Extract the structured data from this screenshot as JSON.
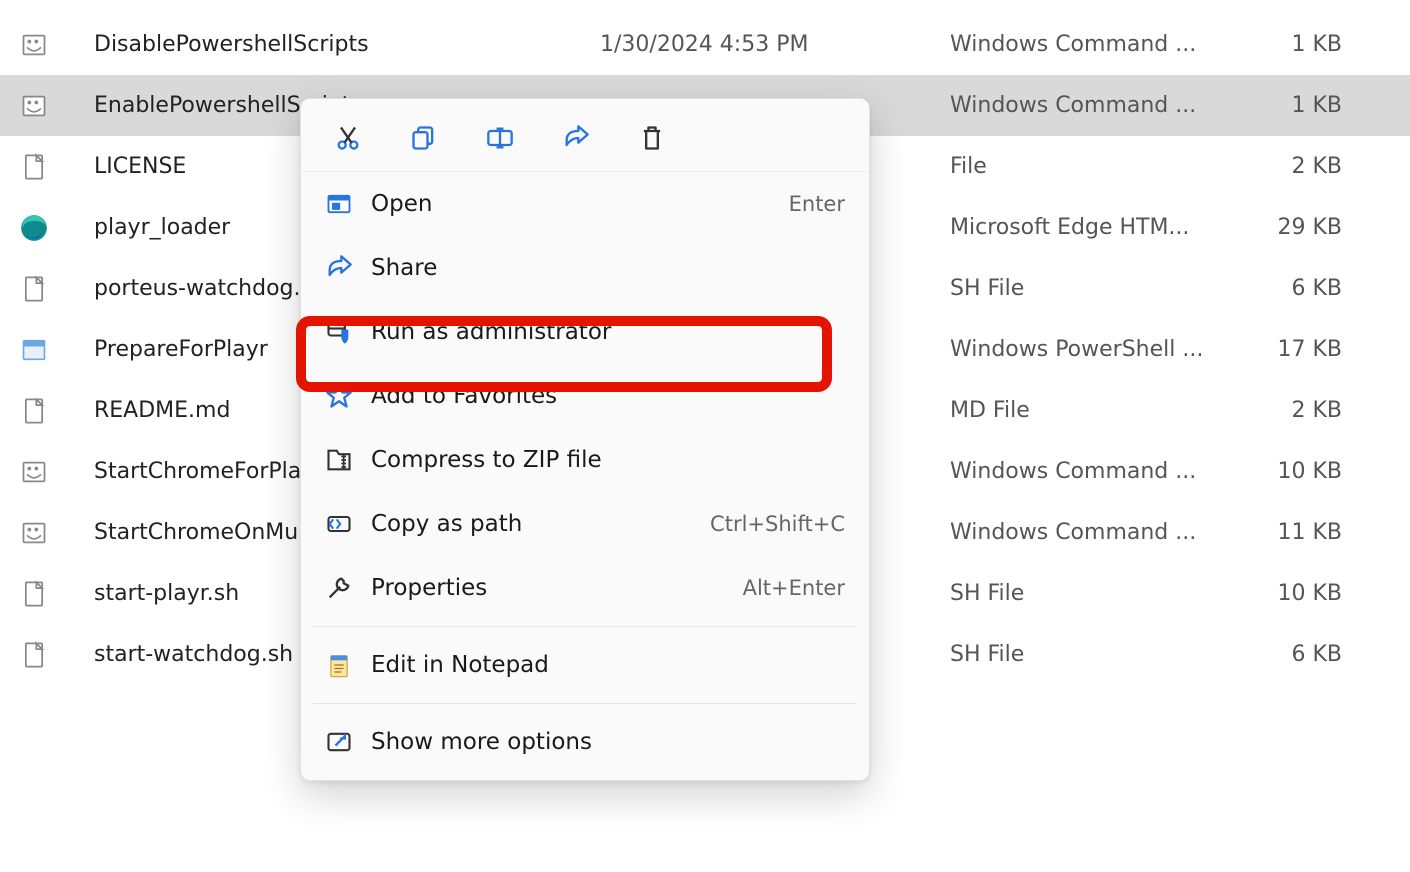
{
  "files": [
    {
      "name": "DisablePowershellScripts",
      "date": "1/30/2024 4:53 PM",
      "type": "Windows Command ...",
      "size": "1 KB",
      "icon": "cmd",
      "selected": false
    },
    {
      "name": "EnablePowershellScript",
      "date": "",
      "type": "Windows Command ...",
      "size": "1 KB",
      "icon": "cmd",
      "selected": true
    },
    {
      "name": "LICENSE",
      "date": "",
      "type": "File",
      "size": "2 KB",
      "icon": "file",
      "selected": false
    },
    {
      "name": "playr_loader",
      "date": "",
      "type": "Microsoft Edge HTM...",
      "size": "29 KB",
      "icon": "edge",
      "selected": false
    },
    {
      "name": "porteus-watchdog.sh",
      "date": "",
      "type": "SH File",
      "size": "6 KB",
      "icon": "file",
      "selected": false
    },
    {
      "name": "PrepareForPlayr",
      "date": "",
      "type": "Windows PowerShell ...",
      "size": "17 KB",
      "icon": "ps1",
      "selected": false
    },
    {
      "name": "README.md",
      "date": "",
      "type": "MD File",
      "size": "2 KB",
      "icon": "file",
      "selected": false
    },
    {
      "name": "StartChromeForPlayr",
      "date": "",
      "type": "Windows Command ...",
      "size": "10 KB",
      "icon": "cmd",
      "selected": false
    },
    {
      "name": "StartChromeOnMultip",
      "date": "",
      "type": "Windows Command ...",
      "size": "11 KB",
      "icon": "cmd",
      "selected": false
    },
    {
      "name": "start-playr.sh",
      "date": "",
      "type": "SH File",
      "size": "10 KB",
      "icon": "file",
      "selected": false
    },
    {
      "name": "start-watchdog.sh",
      "date": "",
      "type": "SH File",
      "size": "6 KB",
      "icon": "file",
      "selected": false
    }
  ],
  "context_menu": {
    "iconbar": [
      "cut",
      "copy",
      "rename",
      "share",
      "delete"
    ],
    "items": [
      {
        "icon": "open",
        "label": "Open",
        "accel": "Enter",
        "highlighted": false
      },
      {
        "icon": "share",
        "label": "Share",
        "accel": "",
        "highlighted": false
      },
      {
        "icon": "shield",
        "label": "Run as administrator",
        "accel": "",
        "highlighted": true
      },
      {
        "icon": "star",
        "label": "Add to Favorites",
        "accel": "",
        "highlighted": false
      },
      {
        "icon": "zip",
        "label": "Compress to ZIP file",
        "accel": "",
        "highlighted": false
      },
      {
        "icon": "path",
        "label": "Copy as path",
        "accel": "Ctrl+Shift+C",
        "highlighted": false
      },
      {
        "icon": "wrench",
        "label": "Properties",
        "accel": "Alt+Enter",
        "highlighted": false
      }
    ],
    "sep1": true,
    "extra1": {
      "icon": "notepad",
      "label": "Edit in Notepad"
    },
    "sep2": true,
    "extra2": {
      "icon": "more",
      "label": "Show more options"
    }
  }
}
